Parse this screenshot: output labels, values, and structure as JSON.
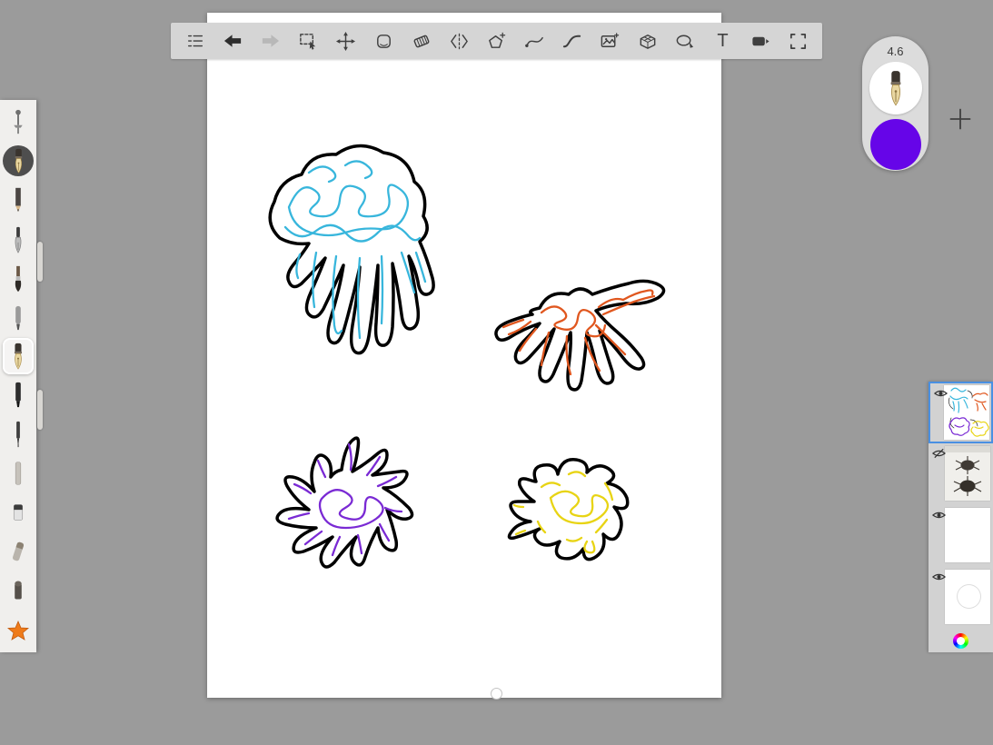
{
  "app": {
    "background_color": "#9b9b9b"
  },
  "toolbar": {
    "background_color": "#d5d5d5",
    "items": [
      {
        "label": "menu",
        "icon": "list-icon",
        "enabled": true
      },
      {
        "label": "undo",
        "icon": "undo-arrow-icon",
        "enabled": true
      },
      {
        "label": "redo",
        "icon": "redo-arrow-icon",
        "enabled": false
      },
      {
        "label": "select",
        "icon": "marquee-select-icon",
        "enabled": true
      },
      {
        "label": "move",
        "icon": "move-arrows-icon",
        "enabled": true
      },
      {
        "label": "eraser",
        "icon": "eraser-block-icon",
        "enabled": true
      },
      {
        "label": "hatch-eraser",
        "icon": "striped-parallelogram-icon",
        "enabled": true
      },
      {
        "label": "split-stroke",
        "icon": "split-chevrons-icon",
        "enabled": true
      },
      {
        "label": "duplicate-shape",
        "icon": "pentagon-plus-icon",
        "enabled": true
      },
      {
        "label": "curve",
        "icon": "curve-dot-icon",
        "enabled": true
      },
      {
        "label": "spline",
        "icon": "s-curve-icon",
        "enabled": true
      },
      {
        "label": "insert-image",
        "icon": "photo-plus-icon",
        "enabled": true
      },
      {
        "label": "perspective-grid",
        "icon": "grid-box-icon",
        "enabled": true
      },
      {
        "label": "shapes",
        "icon": "ellipse-pen-icon",
        "enabled": true
      },
      {
        "label": "text",
        "icon": "text-T-icon",
        "glyph": "T",
        "enabled": true
      },
      {
        "label": "media",
        "icon": "media-card-icon",
        "enabled": true
      },
      {
        "label": "frame",
        "icon": "frame-corners-icon",
        "enabled": true
      }
    ]
  },
  "tool_rail": {
    "tools": [
      {
        "name": "pin-tool",
        "selected": false
      },
      {
        "name": "current-tool-preview",
        "selected": false
      },
      {
        "name": "pencil",
        "selected": false
      },
      {
        "name": "ink-pen",
        "selected": false
      },
      {
        "name": "paint-brush",
        "selected": false
      },
      {
        "name": "airbrush",
        "selected": false
      },
      {
        "name": "fountain-pen",
        "selected": true
      },
      {
        "name": "marker",
        "selected": false
      },
      {
        "name": "fineliner",
        "selected": false
      },
      {
        "name": "pastel",
        "selected": false
      },
      {
        "name": "eraser",
        "selected": false
      },
      {
        "name": "blender",
        "selected": false
      },
      {
        "name": "bullet-marker",
        "selected": false
      },
      {
        "name": "favorites-star",
        "selected": false
      }
    ],
    "star_color": "#ef7b1a"
  },
  "brush_panel": {
    "size_value": "4.6",
    "tool_icon": "fountain-pen-nib-icon",
    "color": "#6605e8"
  },
  "layers_panel": {
    "add_button_icon": "plus-icon",
    "selected_border_color": "#4a90e2",
    "color_wheel_icon": "color-wheel-icon",
    "layers": [
      {
        "name": "creatures-layer",
        "visible": true,
        "selected": true,
        "thumbnail": "four-creature-doodles"
      },
      {
        "name": "photo-layer",
        "visible": false,
        "selected": false,
        "thumbnail": "reference-photo"
      },
      {
        "name": "empty-layer",
        "visible": true,
        "selected": false,
        "thumbnail": "empty"
      },
      {
        "name": "background-layer",
        "visible": true,
        "selected": false,
        "thumbnail": "white-circle"
      }
    ]
  },
  "canvas": {
    "background_color": "#ffffff",
    "outline_color": "#000000",
    "creatures": [
      {
        "name": "jellyfish-doodle",
        "color": "#38b6dc",
        "position": "top-left"
      },
      {
        "name": "crab-doodle",
        "color": "#e0571f",
        "position": "middle-right"
      },
      {
        "name": "spiky-doodle",
        "color": "#7a2ad4",
        "position": "bottom-left"
      },
      {
        "name": "splat-doodle",
        "color": "#e8d414",
        "position": "bottom-right"
      }
    ]
  }
}
